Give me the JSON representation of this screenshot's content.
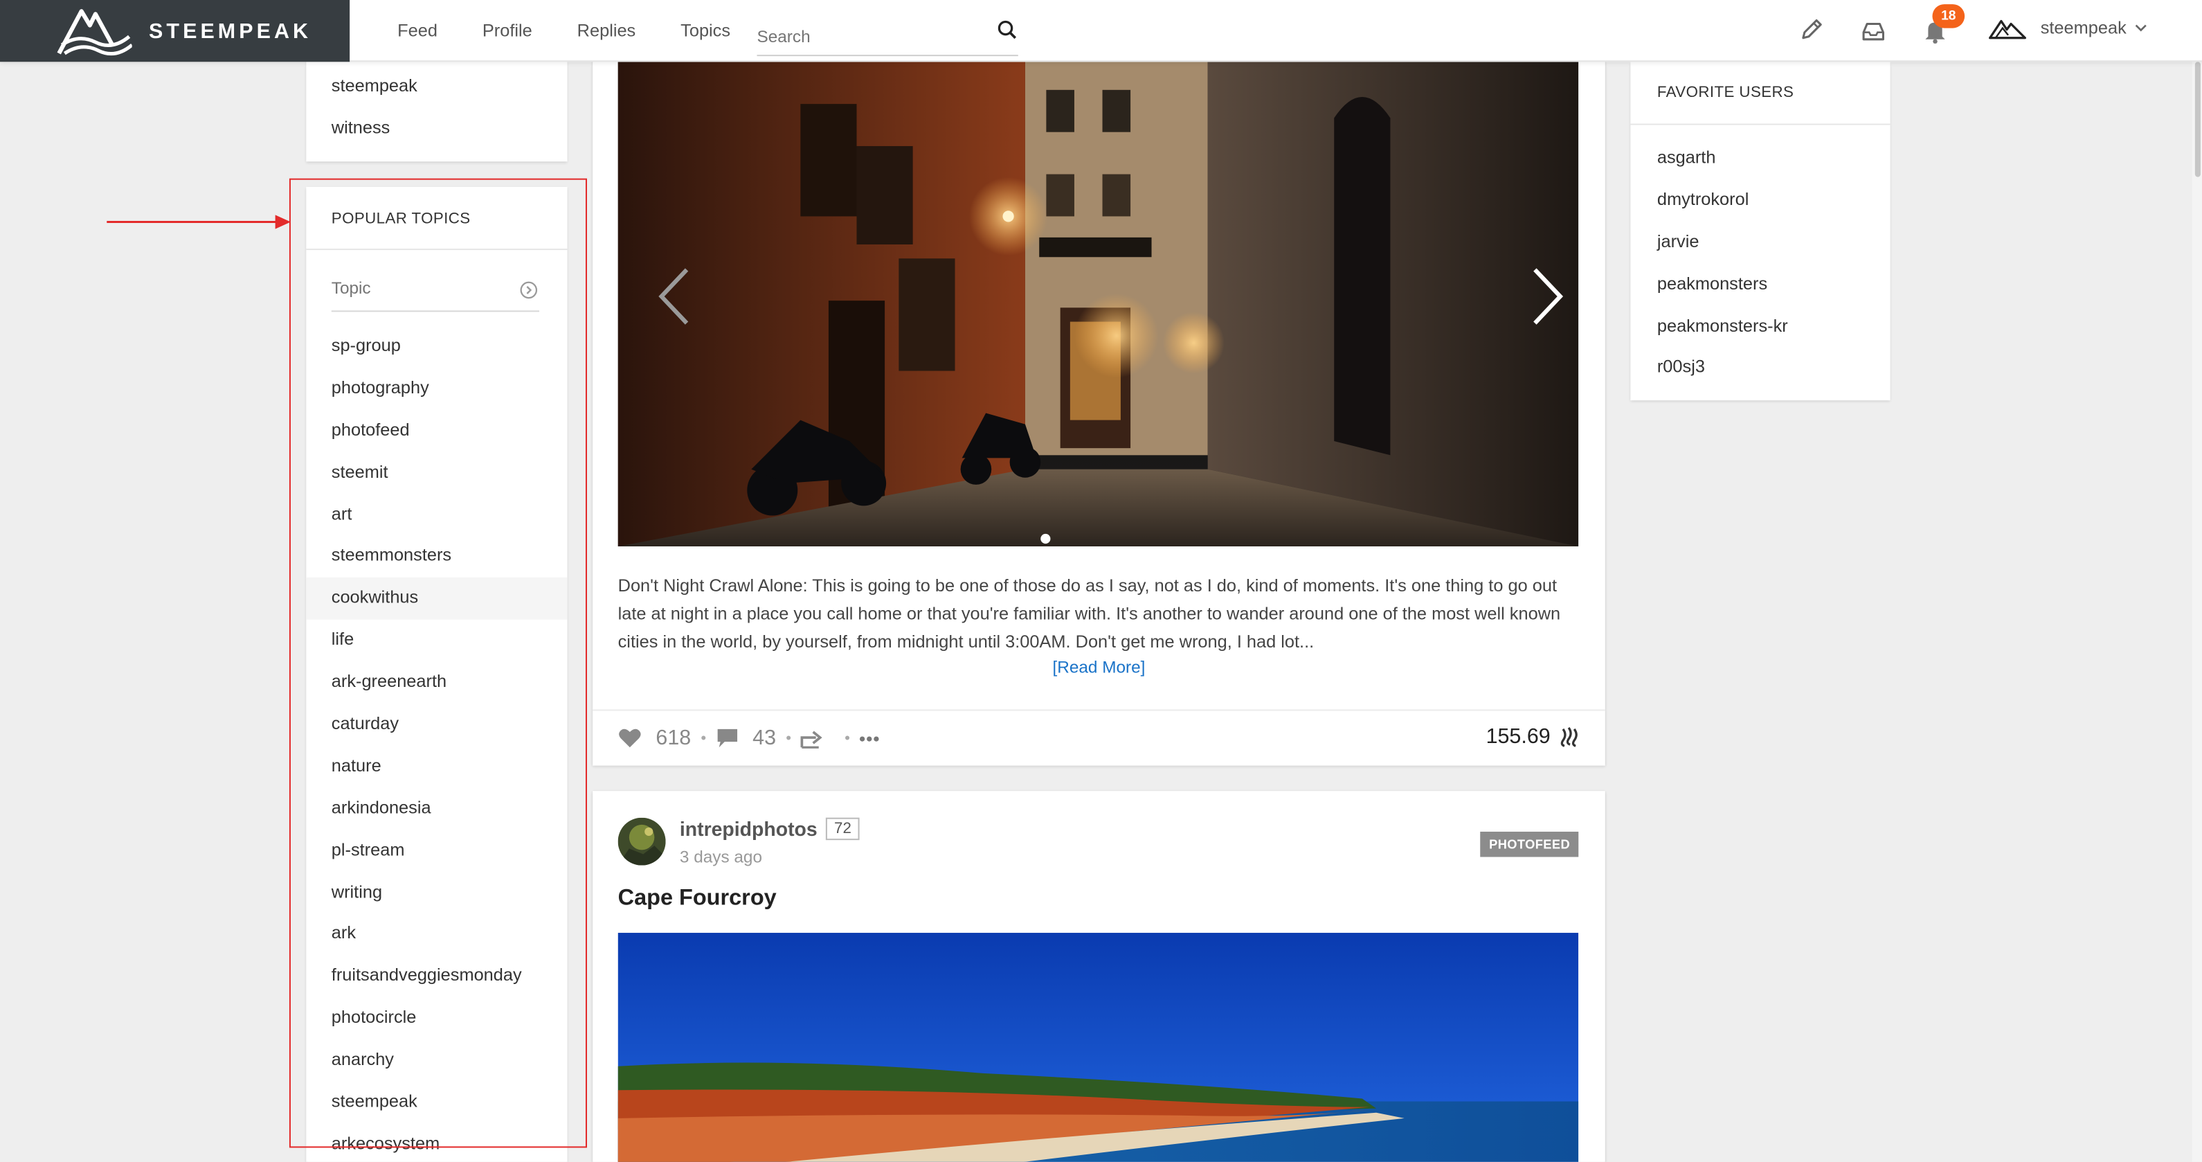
{
  "brand": {
    "name": "STEEMPEAK"
  },
  "nav": {
    "items": [
      "Feed",
      "Profile",
      "Replies",
      "Topics"
    ]
  },
  "search": {
    "placeholder": "Search"
  },
  "header": {
    "notification_count": "18",
    "username": "steempeak"
  },
  "left_card": {
    "items": [
      "steempeak",
      "witness"
    ]
  },
  "popular_topics": {
    "title": "POPULAR TOPICS",
    "input_placeholder": "Topic",
    "items": [
      "sp-group",
      "photography",
      "photofeed",
      "steemit",
      "art",
      "steemmonsters",
      "cookwithus",
      "life",
      "ark-greenearth",
      "caturday",
      "nature",
      "arkindonesia",
      "pl-stream",
      "writing",
      "ark",
      "fruitsandveggiesmonday",
      "photocircle",
      "anarchy",
      "steempeak",
      "arkecosystem"
    ]
  },
  "post": {
    "body": "Don't Night Crawl Alone: This is going to be one of those do as I say, not as I do, kind of moments. It's one thing to go out late at night in a place you call home or that you're familiar with. It's another to wander around one of the most well known cities in the world, by yourself, from midnight until 3:00AM. Don't get me wrong, I had lot...",
    "read_more": "[Read More]",
    "votes": "618",
    "comments": "43",
    "payout": "155.69"
  },
  "post2": {
    "author": "intrepidphotos",
    "reputation": "72",
    "time": "3 days ago",
    "tag": "PHOTOFEED",
    "title": "Cape Fourcroy"
  },
  "favorite_users": {
    "title": "FAVORITE USERS",
    "items": [
      "asgarth",
      "dmytrokorol",
      "jarvie",
      "peakmonsters",
      "peakmonsters-kr",
      "r00sj3"
    ]
  },
  "colors": {
    "brand_bg": "#373d41",
    "badge": "#f4631a",
    "link": "#1a73c8",
    "highlight": "#e32b2b"
  }
}
